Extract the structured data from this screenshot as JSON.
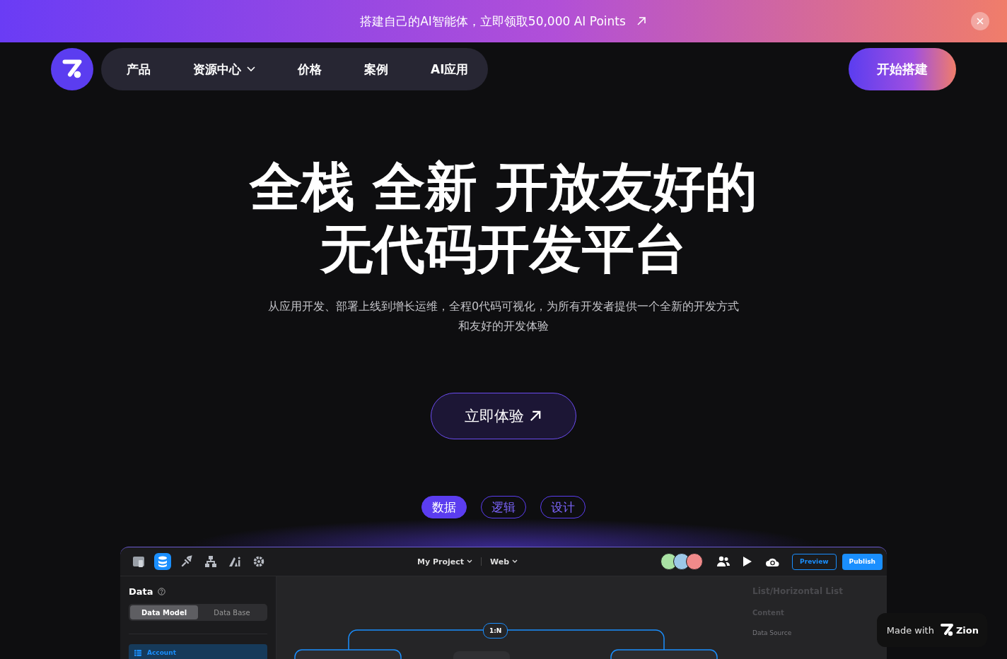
{
  "banner": {
    "text": "搭建自己的AI智能体，立即领取50,000 AI Points"
  },
  "nav": {
    "items": [
      {
        "label": "产品",
        "dropdown": false
      },
      {
        "label": "资源中心",
        "dropdown": true
      },
      {
        "label": "价格",
        "dropdown": false
      },
      {
        "label": "案例",
        "dropdown": false
      },
      {
        "label": "AI应用",
        "dropdown": false
      }
    ],
    "cta": "开始搭建"
  },
  "hero": {
    "title_lines": [
      "全栈 全新 开放友好的",
      "无代码开发平台"
    ],
    "subtitle_lines": [
      "从应用开发、部署上线到增长运维，全程0代码可视化，为所有开发者提供一个全新的开发方式",
      "和友好的开发体验"
    ],
    "button": "立即体验"
  },
  "tabs": [
    {
      "label": "数据",
      "selected": true
    },
    {
      "label": "逻辑",
      "selected": false
    },
    {
      "label": "设计",
      "selected": false
    }
  ],
  "preview": {
    "tools": [
      {
        "kind": "layout",
        "selected": false
      },
      {
        "kind": "database",
        "selected": true
      },
      {
        "kind": "plug",
        "selected": false
      },
      {
        "kind": "tree",
        "selected": false
      },
      {
        "kind": "ai",
        "selected": false
      },
      {
        "kind": "gear",
        "selected": false
      }
    ],
    "project": "My Project",
    "platform": "Web",
    "preview_button": "Preview",
    "publish_button": "Publish",
    "sidebar": {
      "title": "Data",
      "segments": [
        {
          "label": "Data Model",
          "selected": true
        },
        {
          "label": "Data Base",
          "selected": false
        }
      ],
      "items": [
        {
          "label": "Account",
          "selected": true
        }
      ]
    },
    "relation": "1:N",
    "panel": {
      "title": "List/Horizontal List",
      "tab": "Content",
      "field": "Data Source"
    }
  },
  "badge": {
    "made_with": "Made with",
    "brand": "Zion"
  }
}
